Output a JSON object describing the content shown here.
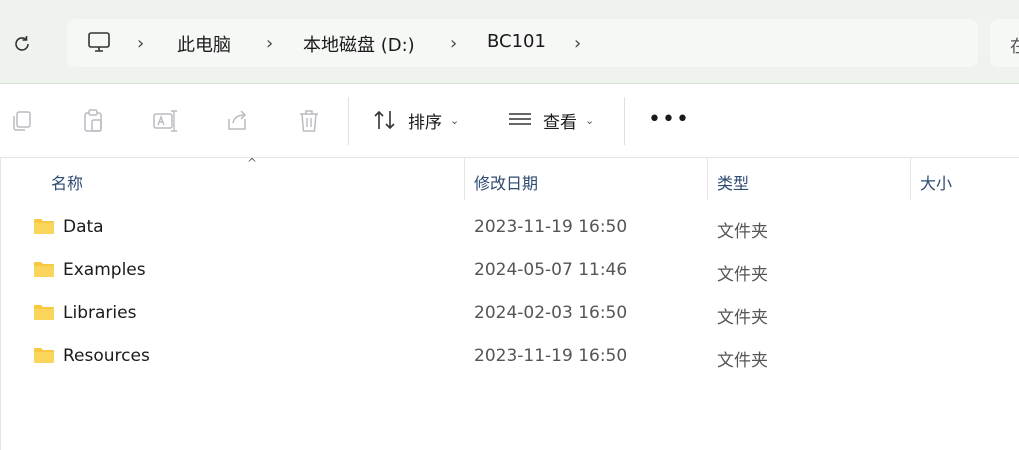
{
  "address_bar": {
    "refresh_icon": "refresh-icon",
    "pc_icon": "computer-icon",
    "crumbs": [
      "此电脑",
      "本地磁盘 (D:)",
      "BC101"
    ],
    "search_partial": "在"
  },
  "toolbar": {
    "icons": [
      "copy-icon",
      "paste-icon",
      "rename-icon",
      "share-icon",
      "delete-icon"
    ],
    "sort_label": "排序",
    "view_label": "查看",
    "more_label": "•••"
  },
  "columns": {
    "name": "名称",
    "date": "修改日期",
    "type": "类型",
    "size": "大小"
  },
  "files": [
    {
      "name": "Data",
      "date": "2023-11-19 16:50",
      "type": "文件夹"
    },
    {
      "name": "Examples",
      "date": "2024-05-07 11:46",
      "type": "文件夹"
    },
    {
      "name": "Libraries",
      "date": "2024-02-03 16:50",
      "type": "文件夹"
    },
    {
      "name": "Resources",
      "date": "2023-11-19 16:50",
      "type": "文件夹"
    }
  ],
  "colors": {
    "header_bg": "#eef3ee",
    "column_header_text": "#2e4b72",
    "folder_yellow": "#f8c843"
  }
}
